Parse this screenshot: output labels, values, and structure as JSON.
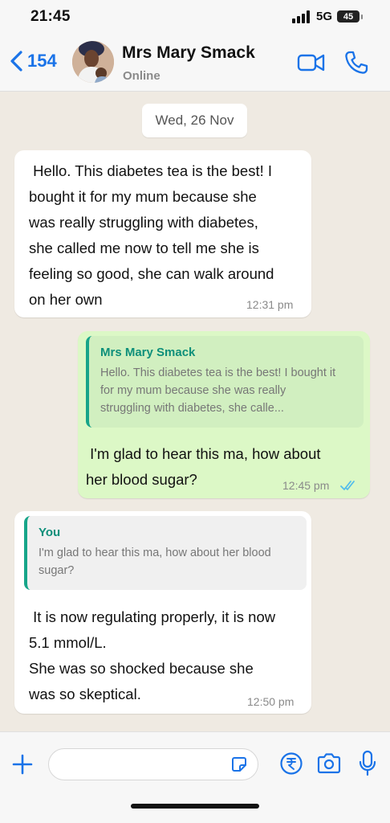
{
  "status_bar": {
    "time": "21:45",
    "network": "5G",
    "battery": "45"
  },
  "header": {
    "back_count": "154",
    "contact_name": "Mrs Mary Smack",
    "contact_status": "Online"
  },
  "date_chip": "Wed, 26 Nov",
  "messages": [
    {
      "direction": "incoming",
      "text": " Hello. This diabetes tea is the best! I\nbought it for my mum because she\nwas really struggling with diabetes,\nshe called me now to tell me she is\nfeeling so good, she can walk around\non her own",
      "time": "12:31 pm"
    },
    {
      "direction": "outgoing",
      "quote": {
        "author": "Mrs Mary Smack",
        "text": "Hello. This diabetes tea is the best! I bought it\nfor my mum because she was really\nstruggling with diabetes, she calle..."
      },
      "text": " I'm glad to hear this ma, how about\nher blood sugar?",
      "time": "12:45 pm",
      "read": true
    },
    {
      "direction": "incoming",
      "quote": {
        "author": "You",
        "text": "I'm glad to hear this ma, how about her blood\nsugar?"
      },
      "text": " It is now regulating properly, it is now\n5.1 mmol/L.\nShe was so shocked because she\nwas so skeptical.",
      "time": "12:50 pm"
    }
  ],
  "input_bar": {
    "placeholder": ""
  },
  "icons": {
    "back": "chevron-left-icon",
    "video": "video-call-icon",
    "phone": "phone-call-icon",
    "plus": "plus-icon",
    "sticker": "sticker-icon",
    "payment": "rupee-icon",
    "camera": "camera-icon",
    "mic": "microphone-icon"
  },
  "colors": {
    "accent": "#1a73e8",
    "outgoing_bubble": "#dcf8c6",
    "incoming_bubble": "#ffffff",
    "quote_bar": "#17a589",
    "read_ticks": "#53bdeb"
  }
}
